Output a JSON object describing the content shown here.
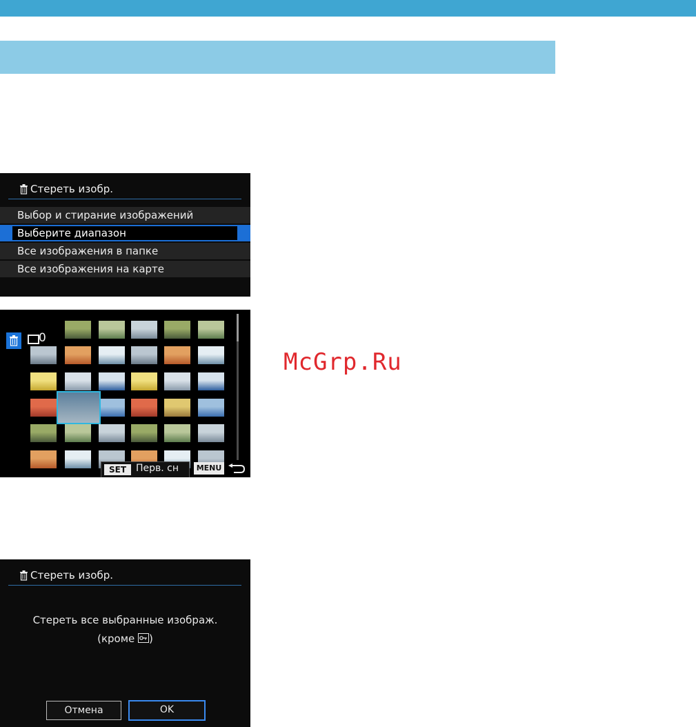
{
  "colors": {
    "top_bar": "#3fa6d2",
    "section_bar": "#8ccbe6",
    "menu_selection": "#1c6fd6",
    "grid_selection": "#30b7e0",
    "watermark": "#e0282d"
  },
  "menu_screen": {
    "title": "Стереть изобр.",
    "title_icon": "trash-icon",
    "items": [
      {
        "label": "Выбор и стирание изображений"
      },
      {
        "label": "Выберите диапазон"
      },
      {
        "label": "Все изображения в папке"
      },
      {
        "label": "Все изображения на карте"
      }
    ],
    "selected_index": 1
  },
  "grid_screen": {
    "trash_icon": "trash-icon",
    "selected_count": "0",
    "set_button_label": "SET",
    "set_action_label": "Перв. сн",
    "menu_button_label": "MENU",
    "back_icon": "back-arrow-icon"
  },
  "confirm_screen": {
    "title": "Стереть изобр.",
    "message_line1": "Стереть все выбранные изображ.",
    "message_line2_prefix": "(кроме",
    "message_line2_suffix": ")",
    "protect_icon": "protect-key-icon",
    "cancel_label": "Отмена",
    "ok_label": "OK"
  },
  "watermark": "McGrp.Ru"
}
